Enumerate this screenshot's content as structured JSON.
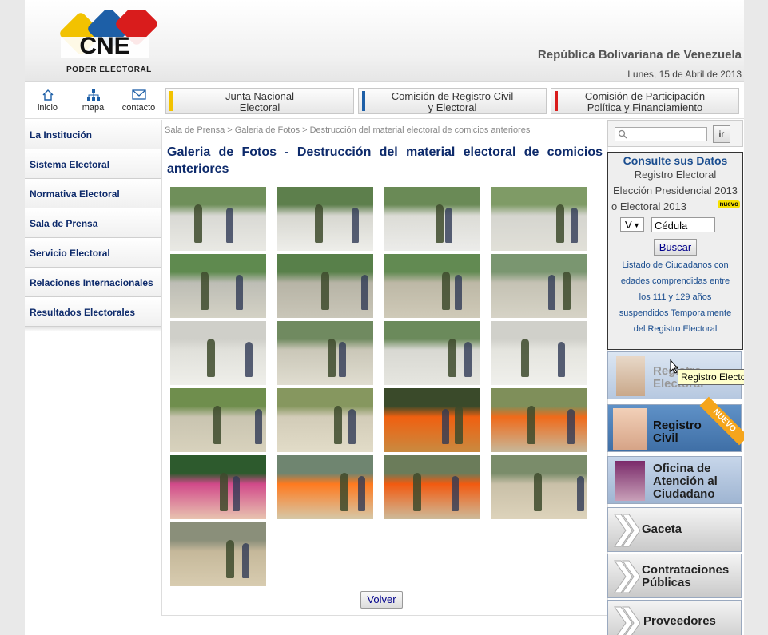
{
  "header": {
    "logo_text": "CNE",
    "logo_sub": "PODER ELECTORAL",
    "title": "República Bolivariana de Venezuela",
    "date": "Lunes, 15 de Abril de 2013"
  },
  "quicklinks": [
    {
      "label": "inicio",
      "icon": "home-icon"
    },
    {
      "label": "mapa",
      "icon": "sitemap-icon"
    },
    {
      "label": "contacto",
      "icon": "mail-icon"
    }
  ],
  "tabs": [
    {
      "line1": "Junta Nacional",
      "line2": "Electoral",
      "color": "#f2c200"
    },
    {
      "line1": "Comisión de Registro Civil",
      "line2": "y Electoral",
      "color": "#1d5fa7"
    },
    {
      "line1": "Comisión de Participación",
      "line2": "Política y Financiamiento",
      "color": "#d91c1c"
    }
  ],
  "left_menu": [
    "La Institución",
    "Sistema Electoral",
    "Normativa Electoral",
    "Sala de Prensa",
    "Servicio Electoral",
    "Relaciones Internacionales",
    "Resultados Electorales"
  ],
  "breadcrumb": "Sala de Prensa > Galeria de Fotos > Destrucción del material electoral de comicios anteriores",
  "page_title": "Galeria de Fotos - Destrucción del material electoral de comicios anteriores",
  "gallery_count": 21,
  "volver_label": "Volver",
  "search": {
    "button": "ir"
  },
  "consulte": {
    "title": "Consulte sus Datos",
    "line1": "Registro Electoral",
    "line2": "Elección Presidencial 2013",
    "line3": "o Electoral 2013",
    "badge": "nuevo",
    "select_value": "V",
    "cedula_value": "Cédula",
    "buscar": "Buscar",
    "link1": "Listado de Ciudadanos con",
    "link2": "edades comprendidas entre",
    "link3": "los 111 y 129 años",
    "link4": "suspendidos Temporalmente",
    "link5": "del Registro Electoral"
  },
  "banners": [
    {
      "line1": "Registro",
      "line2": "Electoral",
      "line3": ""
    },
    {
      "line1": "Registro",
      "line2": "Civil",
      "line3": "",
      "ribbon": "NUEVO"
    },
    {
      "line1": "Oficina de",
      "line2": "Atención al",
      "line3": "Ciudadano"
    },
    {
      "line1": "Gaceta",
      "line2": "",
      "line3": ""
    },
    {
      "line1": "Contrataciones",
      "line2": "Públicas",
      "line3": ""
    },
    {
      "line1": "Proveedores",
      "line2": "",
      "line3": ""
    }
  ],
  "tooltip": "Registro Electoral"
}
